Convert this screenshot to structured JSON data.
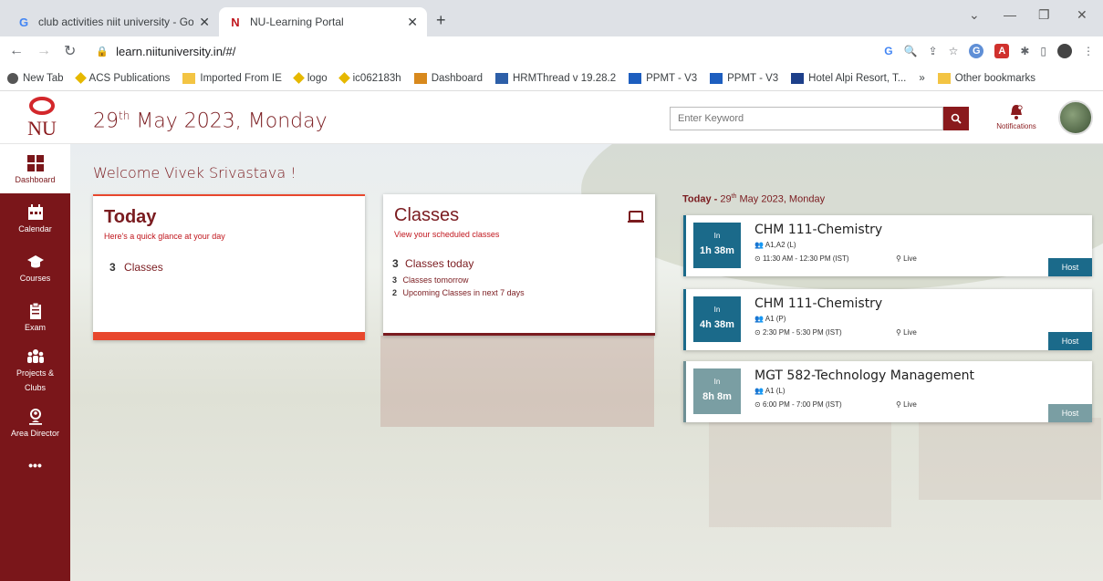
{
  "browser": {
    "tabs": [
      {
        "title": "club activities niit university - Go",
        "active": false
      },
      {
        "title": "NU-Learning Portal",
        "active": true
      }
    ],
    "url": "learn.niituniversity.in/#/",
    "bookmarks": [
      "New Tab",
      "ACS Publications",
      "Imported From IE",
      "logo",
      "ic062183h",
      "Dashboard",
      "HRMThread v 19.28.2",
      "PPMT - V3",
      "PPMT - V3",
      "Hotel Alpi Resort, T..."
    ],
    "other_bookmarks": "Other bookmarks",
    "more": "»"
  },
  "header": {
    "logo_text": "NU",
    "date_day": "29",
    "date_suffix": "th",
    "date_rest": " May 2023, Monday",
    "search_placeholder": "Enter Keyword",
    "notifications_label": "Notifications"
  },
  "sidebar": {
    "items": [
      {
        "label": "Dashboard",
        "icon": "dashboard-icon"
      },
      {
        "label": "Calendar",
        "icon": "calendar-icon"
      },
      {
        "label": "Courses",
        "icon": "graduation-cap-icon"
      },
      {
        "label": "Exam",
        "icon": "clipboard-icon"
      },
      {
        "label": "Projects &",
        "label2": "Clubs",
        "icon": "group-icon"
      },
      {
        "label": "Area Director",
        "icon": "person-pin-icon"
      },
      {
        "label": "•••",
        "icon": "more-icon"
      }
    ]
  },
  "main": {
    "welcome": "Welcome Vivek Srivastava !",
    "today_card": {
      "title": "Today",
      "subtitle": "Here's a quick glance at your day",
      "count": "3",
      "label": "Classes"
    },
    "classes_card": {
      "title": "Classes",
      "subtitle": "View your scheduled classes",
      "today_count": "3",
      "today_label": "Classes today",
      "tomorrow_count": "3",
      "tomorrow_label": "Classes tomorrow",
      "upcoming_count": "2",
      "upcoming_label": "Upcoming Classes in next 7 days"
    },
    "schedule_header": {
      "prefix": "Today - ",
      "day": "29",
      "suffix": "th",
      "rest": " May 2023, Monday"
    },
    "schedule": [
      {
        "in": "In",
        "countdown": "1h 38m",
        "course": "CHM 111-Chemistry",
        "group": "A1,A2 (L)",
        "time": "11:30 AM - 12:30 PM (IST)",
        "mode": "Live",
        "action": "Host"
      },
      {
        "in": "In",
        "countdown": "4h 38m",
        "course": "CHM 111-Chemistry",
        "group": "A1 (P)",
        "time": "2:30 PM - 5:30 PM (IST)",
        "mode": "Live",
        "action": "Host"
      },
      {
        "in": "In",
        "countdown": "8h 8m",
        "course": "MGT 582-Technology Management",
        "group": "A1 (L)",
        "time": "6:00 PM - 7:00 PM (IST)",
        "mode": "Live",
        "action": "Host"
      }
    ]
  },
  "colors": {
    "brand": "#7a161a",
    "accent": "#e8472d",
    "schedule_blue": "#1b6a8a",
    "schedule_gray": "#7a9ea3"
  }
}
